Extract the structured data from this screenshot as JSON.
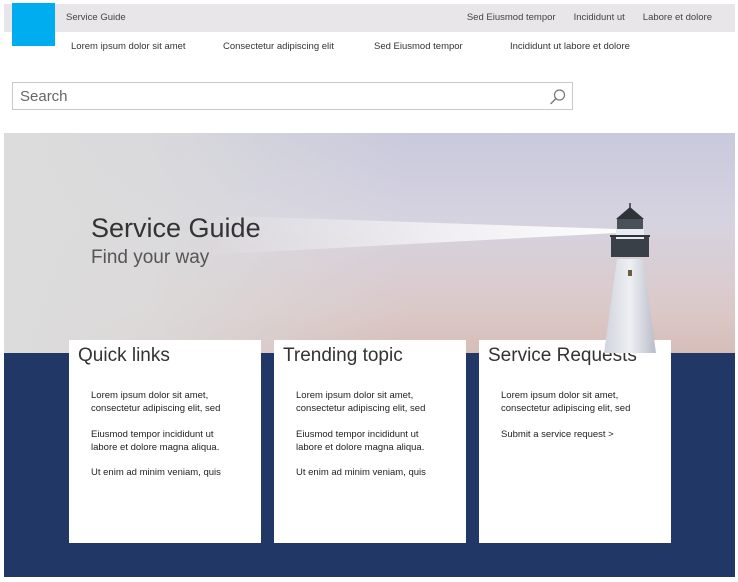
{
  "header": {
    "site_title": "Service Guide",
    "top_links": [
      "Sed Eiusmod tempor",
      "Incididunt ut",
      "Labore et dolore"
    ],
    "logo_color": "#00adef"
  },
  "subnav": {
    "items": [
      "Lorem ipsum dolor sit amet",
      "Consectetur adipiscing elit",
      "Sed Eiusmod tempor",
      "Incididunt ut labore et dolore"
    ]
  },
  "search": {
    "placeholder": "Search",
    "icon": "search-icon"
  },
  "hero": {
    "title": "Service Guide",
    "subtitle": "Find your way",
    "image": "lighthouse"
  },
  "colors": {
    "band": "#213867",
    "accent": "#00adef"
  },
  "cards": [
    {
      "title": "Quick links",
      "lines": [
        "Lorem ipsum dolor sit amet,",
        "consectetur adipiscing elit, sed",
        "Eiusmod tempor incididunt ut",
        "labore et dolore magna aliqua.",
        "Ut enim ad minim veniam, quis"
      ]
    },
    {
      "title": "Trending topic",
      "lines": [
        "Lorem ipsum dolor sit amet,",
        "consectetur adipiscing elit, sed",
        "Eiusmod tempor incididunt ut",
        "labore et dolore magna aliqua.",
        "Ut enim ad minim veniam, quis"
      ]
    },
    {
      "title": "Service Requests",
      "lines": [
        "Lorem ipsum dolor sit amet,",
        "consectetur adipiscing elit, sed"
      ],
      "link": "Submit a service request >"
    }
  ]
}
